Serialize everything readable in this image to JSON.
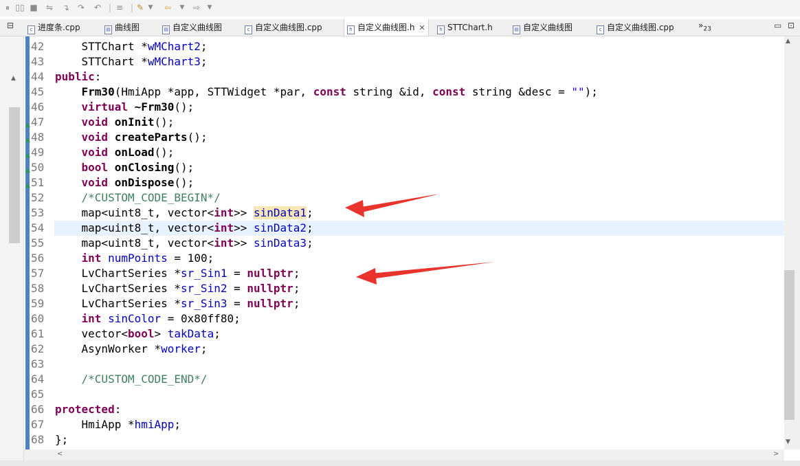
{
  "toolbar": {
    "icons": [
      "pause-icon",
      "stop-icon",
      "step-icon",
      "step-into-icon",
      "step-over-icon",
      "step-return-icon",
      "menu-icon",
      "build-icon",
      "dropdown-icon",
      "back-icon",
      "dropdown-icon",
      "forward-icon",
      "dropdown-icon"
    ]
  },
  "tabs": [
    {
      "label": "进度条.cpp",
      "file_type": "c"
    },
    {
      "label": "曲线图",
      "file_type": "ui"
    },
    {
      "label": "自定义曲线图",
      "file_type": "ui"
    },
    {
      "label": "自定义曲线图.cpp",
      "file_type": "c"
    },
    {
      "label": "自定义曲线图.h",
      "file_type": "h",
      "active": true
    },
    {
      "label": "STTChart.h",
      "file_type": "h"
    },
    {
      "label": "自定义曲线图",
      "file_type": "ui"
    },
    {
      "label": "自定义曲线图.cpp",
      "file_type": "c"
    }
  ],
  "tabs_overflow": {
    "label": "»",
    "count": "23"
  },
  "editor": {
    "lines": [
      {
        "n": "42",
        "code": "    STTChart *wMChart2;"
      },
      {
        "n": "43",
        "code": "    STTChart *wMChart3;"
      },
      {
        "n": "44",
        "code": "public:"
      },
      {
        "n": "45",
        "code": "    Frm30(HmiApp *app, STTWidget *par, const string &id, const string &desc = \"\");"
      },
      {
        "n": "46",
        "code": "    virtual ~Frm30();"
      },
      {
        "n": "47",
        "code": "    void onInit();"
      },
      {
        "n": "48",
        "code": "    void createParts();"
      },
      {
        "n": "49",
        "code": "    void onLoad();"
      },
      {
        "n": "50",
        "code": "    bool onClosing();"
      },
      {
        "n": "51",
        "code": "    void onDispose();"
      },
      {
        "n": "52",
        "code": "    /*CUSTOM_CODE_BEGIN*/"
      },
      {
        "n": "53",
        "code": "    map<uint8_t, vector<int>> sinData1;"
      },
      {
        "n": "54",
        "code": "    map<uint8_t, vector<int>> sinData2;"
      },
      {
        "n": "55",
        "code": "    map<uint8_t, vector<int>> sinData3;"
      },
      {
        "n": "56",
        "code": "    int numPoints = 100;"
      },
      {
        "n": "57",
        "code": "    LvChartSeries *sr_Sin1 = nullptr;"
      },
      {
        "n": "58",
        "code": "    LvChartSeries *sr_Sin2 = nullptr;"
      },
      {
        "n": "59",
        "code": "    LvChartSeries *sr_Sin3 = nullptr;"
      },
      {
        "n": "60",
        "code": "    int sinColor = 0x80ff80;"
      },
      {
        "n": "61",
        "code": "    vector<bool> takData;"
      },
      {
        "n": "62",
        "code": "    AsynWorker *worker;"
      },
      {
        "n": "63",
        "code": ""
      },
      {
        "n": "64",
        "code": "    /*CUSTOM_CODE_END*/"
      },
      {
        "n": "65",
        "code": ""
      },
      {
        "n": "66",
        "code": "protected:"
      },
      {
        "n": "67",
        "code": "    HmiApp *hmiApp;"
      },
      {
        "n": "68",
        "code": "};"
      }
    ],
    "current_line": "54",
    "highlighted_word": "sinData1",
    "override_lines": [
      "47",
      "48",
      "49",
      "50",
      "51"
    ]
  },
  "annotations": {
    "arrow_color": "#e8342c",
    "count": 2
  },
  "colors": {
    "keyword": "#7f0055",
    "variable": "#0000c0",
    "comment": "#3f7f5f",
    "current_line": "#e8f2fe",
    "highlight": "#f7e6b7",
    "marker": "#4f80c9"
  }
}
